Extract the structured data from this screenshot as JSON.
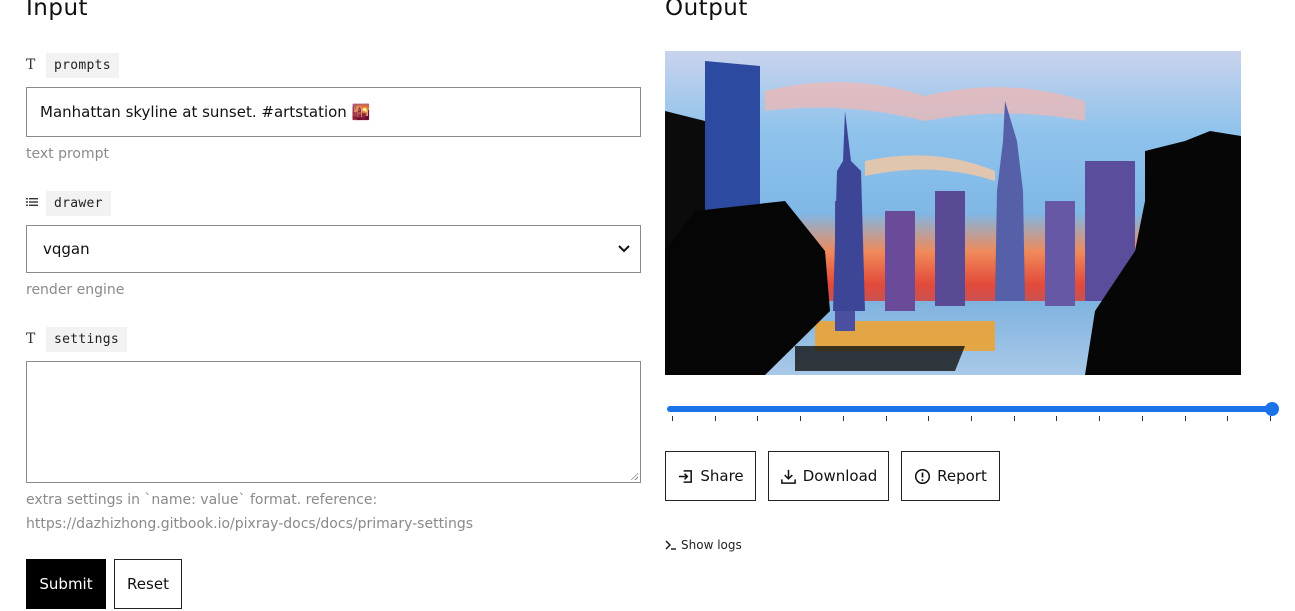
{
  "input": {
    "title": "Input",
    "fields": [
      {
        "type_icon": "T",
        "name": "prompts",
        "value": "Manhattan skyline at sunset. #artstation 🌇",
        "hint": "text prompt"
      },
      {
        "type_icon": "≡",
        "name": "drawer",
        "value": "vqgan",
        "hint": "render engine"
      },
      {
        "type_icon": "T",
        "name": "settings",
        "value": "",
        "hint_line1": "extra settings in `name: value` format. reference:",
        "hint_line2": "https://dazhizhong.gitbook.io/pixray-docs/docs/primary-settings"
      }
    ],
    "submit_label": "Submit",
    "reset_label": "Reset"
  },
  "output": {
    "title": "Output",
    "progress": 1.0,
    "share_label": "Share",
    "download_label": "Download",
    "report_label": "Report",
    "logs_label": "Show logs",
    "logs_icon": ">_"
  },
  "colors": {
    "accent": "#1a73e8",
    "submit_bg": "#000000"
  }
}
